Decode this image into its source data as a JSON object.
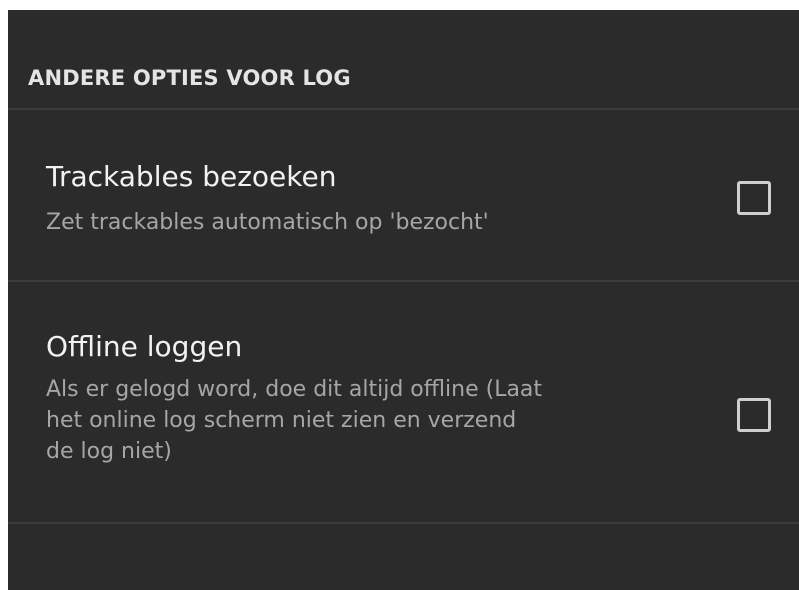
{
  "category": {
    "title": "ANDERE OPTIES VOOR LOG"
  },
  "preferences": [
    {
      "title": "Trackables bezoeken",
      "summary": "Zet trackables automatisch op 'bezocht'",
      "checked": false
    },
    {
      "title": "Offline loggen",
      "summary_lines": [
        "Als er gelogd word, doe dit altijd offline (Laat",
        "het online log scherm niet zien en verzend",
        "de log niet)"
      ],
      "checked": false
    }
  ],
  "colors": {
    "background": "#2b2b2b",
    "divider": "#3c3c3c",
    "title_text": "#f2f2f2",
    "summary_text": "#a6a6a6",
    "checkbox_border": "#cfcfcf"
  }
}
